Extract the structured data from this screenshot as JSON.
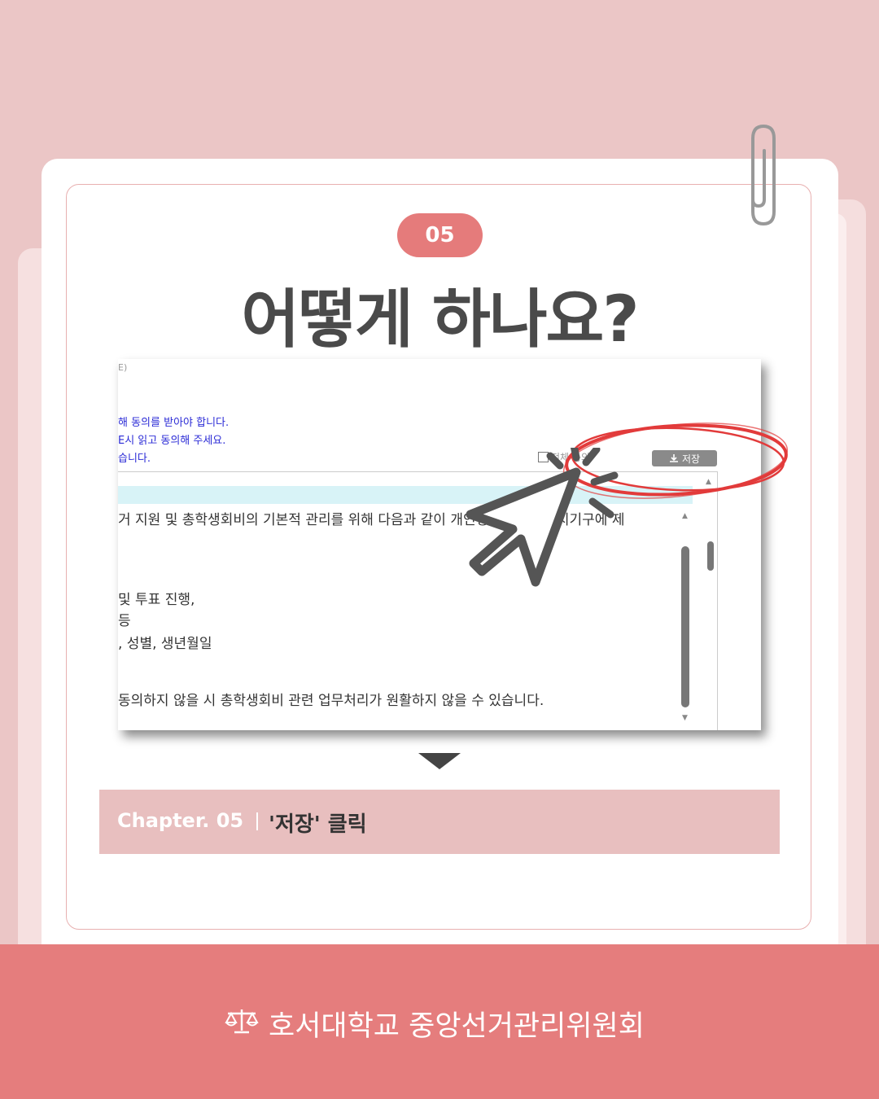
{
  "badge": "05",
  "title": "어떻게 하나요?",
  "screenshot": {
    "top_fragment": "E)",
    "notice_lines": [
      "해 동의를 받아야 합니다.",
      "E시 읽고 동의해 주세요.",
      "습니다."
    ],
    "agree_label": "전체 동의",
    "save_button": "저장",
    "body_lines": [
      "거 지원 및 총학생회비의 기본적 관리를 위해 다음과 같이 개인정보를 학생자치기구에 제",
      "및 투표 진행,",
      "등",
      ", 성별, 생년월일",
      "동의하지 않을 시 총학생회비 관련 업무처리가 원활하지 않을 수 있습니다."
    ]
  },
  "chapter": {
    "label": "Chapter. 05",
    "text": "'저장' 클릭"
  },
  "footer": {
    "org": "호서대학교 중앙선거관리위원회"
  },
  "colors": {
    "background": "#ebc6c6",
    "accent": "#e57b7b",
    "chapter_bar": "#e8bfbf",
    "circle": "#e23b3b"
  },
  "icons": [
    "paperclip-icon",
    "download-icon",
    "cursor-pointer-icon",
    "scales-icon",
    "caret-down-icon"
  ]
}
